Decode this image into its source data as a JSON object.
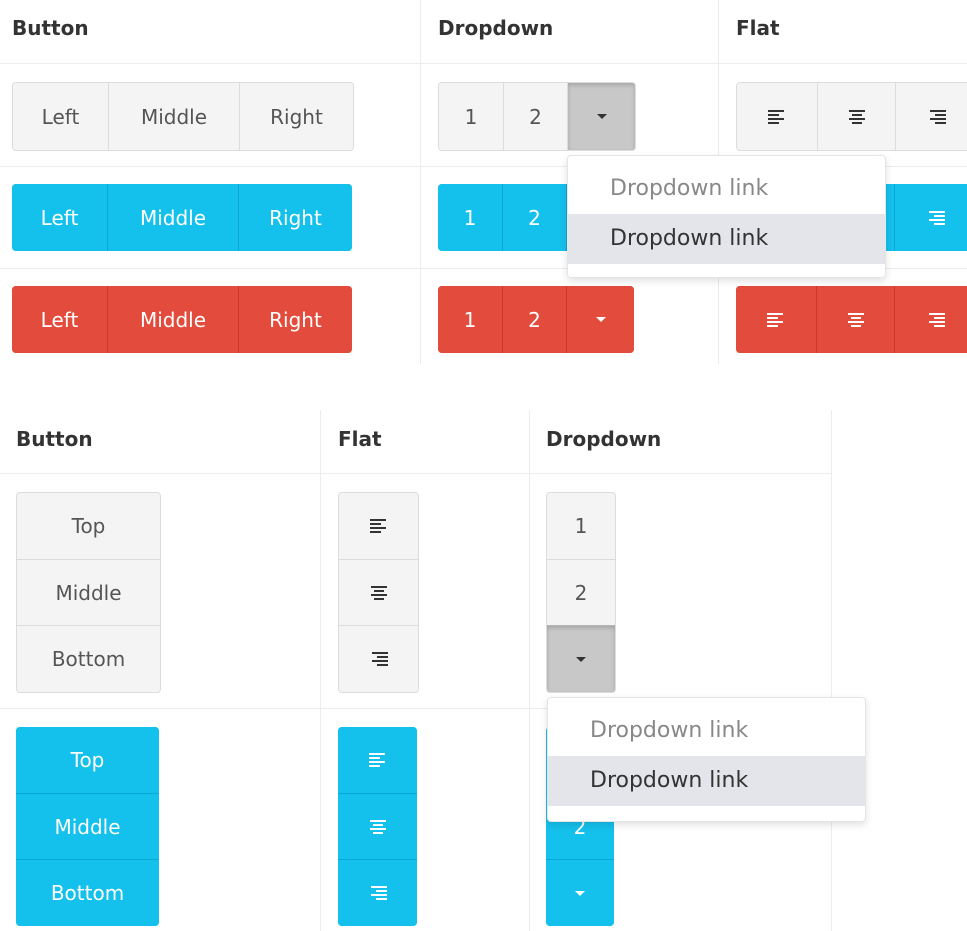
{
  "headers": {
    "top_button": "Button",
    "top_dropdown": "Dropdown",
    "top_flat": "Flat",
    "bottom_button": "Button",
    "bottom_flat": "Flat",
    "bottom_dropdown": "Dropdown"
  },
  "horizontal_buttons": [
    "Left",
    "Middle",
    "Right"
  ],
  "dropdown_numbers": [
    "1",
    "2"
  ],
  "vertical_buttons": [
    "Top",
    "Middle",
    "Bottom"
  ],
  "dropdown_menu_top": [
    "Dropdown link",
    "Dropdown link"
  ],
  "dropdown_menu_bottom": [
    "Dropdown link",
    "Dropdown link"
  ],
  "icons": {
    "align_left": "align-left-icon",
    "align_center": "align-center-icon",
    "align_right": "align-right-icon",
    "caret": "caret-down-icon"
  },
  "colors": {
    "default_bg": "#f4f4f4",
    "info": "#14c0ec",
    "danger": "#e34b3c",
    "menu_hover": "#e4e5ea"
  }
}
